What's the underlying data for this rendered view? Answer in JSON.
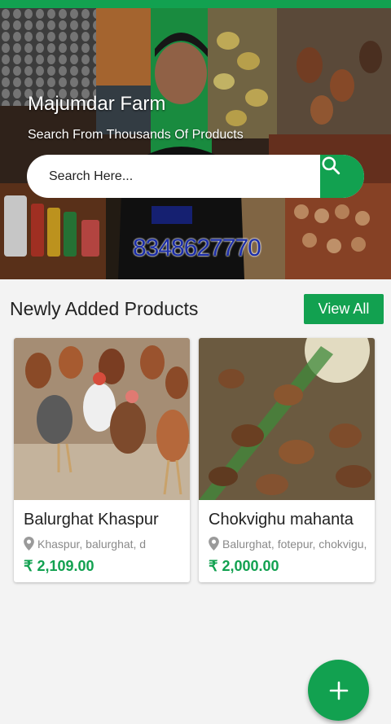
{
  "hero": {
    "title": "Majumdar Farm",
    "subtitle": "Search From Thousands Of Products",
    "phone_overlay": "8348627770"
  },
  "search": {
    "placeholder": "Search Here...",
    "icon": "search-icon"
  },
  "section": {
    "title": "Newly Added Products",
    "view_all_label": "View All"
  },
  "products": [
    {
      "name": "Balurghat Khaspur",
      "location": "Khaspur, balurghat, d",
      "price": "₹ 2,109.00"
    },
    {
      "name": "Chokvighu mahanta",
      "location": "Balurghat, fotepur, chokvigu,",
      "price": "₹ 2,000.00"
    }
  ],
  "fab": {
    "icon": "plus-icon"
  },
  "colors": {
    "accent": "#12a150"
  }
}
